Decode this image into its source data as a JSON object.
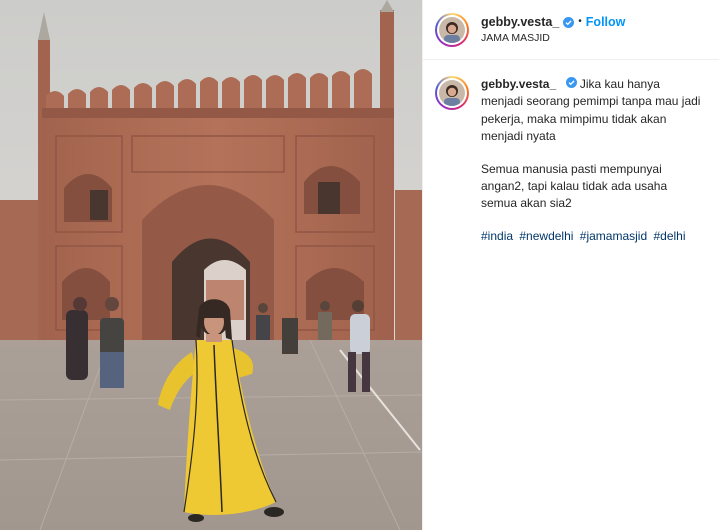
{
  "post": {
    "username": "gebby.vesta_",
    "follow_label": "Follow",
    "separator": "•",
    "location": "JAMA MASJID"
  },
  "caption": {
    "username": "gebby.vesta_",
    "paragraph_1": "Jika kau hanya menjadi seorang pemimpi tanpa mau jadi pekerja, maka mimpimu tidak akan menjadi nyata",
    "paragraph_2": "Semua manusia pasti mempunyai angan2, tapi kalau tidak ada usaha semua akan sia2",
    "hashtags": [
      "#india",
      "#newdelhi",
      "#jamamasjid",
      "#delhi"
    ]
  },
  "icons": {
    "verified": "verified-badge-icon",
    "avatar": "profile-avatar"
  },
  "colors": {
    "link_blue": "#0095f6",
    "hashtag_blue": "#00376b",
    "verified_blue": "#3897f0"
  }
}
